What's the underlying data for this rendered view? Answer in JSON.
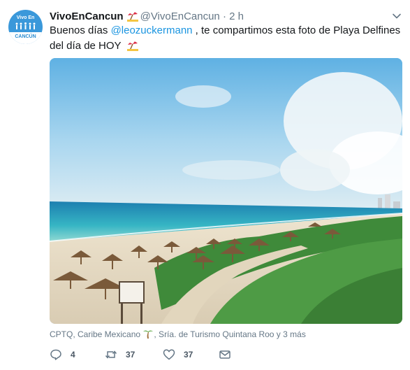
{
  "avatar": {
    "top_text": "Vivo En",
    "bottom_text": "CANCÚN"
  },
  "tweet": {
    "display_name": "VivoEnCancun",
    "handle": "@VivoEnCancun",
    "separator": "·",
    "time": "2 h",
    "text_before_mention": "Buenos días ",
    "mention": "@leozuckermann",
    "text_after_mention": " , te compartimos esta foto de Playa Delfines del día de HOY",
    "icons": {
      "name_emoji": "beach-umbrella-icon",
      "text_emoji": "beach-umbrella-icon",
      "caret": "chevron-down-icon",
      "tag_palm": "palm-tree-icon"
    }
  },
  "photo": {
    "description_name": "playa-delfines-photo"
  },
  "tags": {
    "before_palm": "CPTQ, Caribe Mexicano ",
    "after_palm": ", Sría. de Turismo Quintana Roo y 3 más"
  },
  "actions": {
    "reply_count": "4",
    "retweet_count": "37",
    "like_count": "37"
  },
  "colors": {
    "link": "#1b95e0",
    "secondary_text": "#657786",
    "avatar_bg": "#3a98da"
  }
}
